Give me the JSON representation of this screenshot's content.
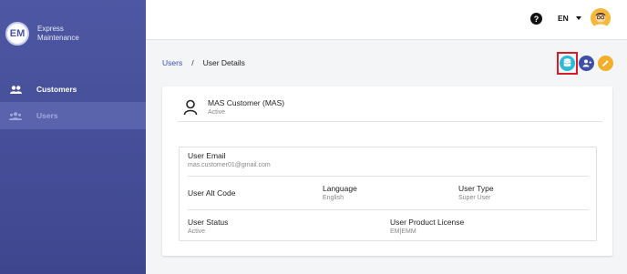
{
  "brand": {
    "line1": "Express",
    "line2": "Maintenance",
    "logo_text": "EM"
  },
  "sidebar": {
    "items": [
      {
        "label": "Customers",
        "icon": "group-icon"
      },
      {
        "label": "Users",
        "icon": "users-icon"
      }
    ]
  },
  "topbar": {
    "help_icon": "help-icon",
    "language": "EN"
  },
  "breadcrumb": {
    "parent": "Users",
    "separator": "/",
    "current": "User Details"
  },
  "actions": [
    {
      "icon": "database-icon",
      "color": "#2bbbd8",
      "highlighted": true
    },
    {
      "icon": "user-switch-icon",
      "color": "#3f4fa8"
    },
    {
      "icon": "pencil-icon",
      "color": "#f3ae2a"
    }
  ],
  "profile": {
    "name": "MAS Customer (MAS)",
    "status": "Active"
  },
  "details": {
    "email_label": "User Email",
    "email_value": "mas.customer01@gmail.com",
    "alt_code_label": "User Alt Code",
    "language_label": "Language",
    "language_value": "English",
    "type_label": "User Type",
    "type_value": "Super User",
    "status_label": "User Status",
    "status_value": "Active",
    "license_label": "User Product License",
    "license_value": "EM|EMM"
  }
}
